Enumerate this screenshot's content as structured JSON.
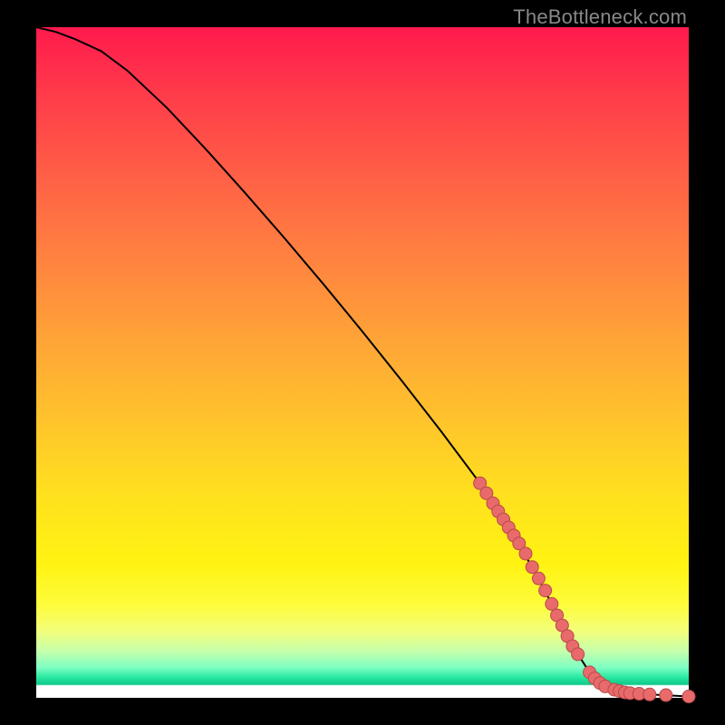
{
  "watermark": "TheBottleneck.com",
  "chart_data": {
    "type": "line",
    "title": "",
    "xlabel": "",
    "ylabel": "",
    "xlim": [
      0,
      100
    ],
    "ylim": [
      0,
      100
    ],
    "grid": false,
    "curve": {
      "x": [
        0,
        3,
        6,
        10,
        14,
        20,
        26,
        32,
        38,
        44,
        50,
        56,
        62,
        68,
        72,
        76,
        79,
        81,
        83,
        85,
        88,
        92,
        96,
        100
      ],
      "y": [
        100,
        99.3,
        98.2,
        96.4,
        93.5,
        88.0,
        81.8,
        75.3,
        68.6,
        61.7,
        54.6,
        47.3,
        39.8,
        32.0,
        26.0,
        19.5,
        14.0,
        10.0,
        6.5,
        3.5,
        1.5,
        0.6,
        0.4,
        0.2
      ]
    },
    "markers": {
      "x": [
        68.0,
        69.0,
        70.0,
        70.8,
        71.6,
        72.4,
        73.2,
        74.0,
        75.0,
        76.0,
        77.0,
        78.0,
        79.0,
        79.8,
        80.6,
        81.4,
        82.2,
        83.0,
        84.8,
        85.6,
        86.4,
        87.2,
        88.6,
        89.4,
        90.2,
        91.0,
        92.4,
        94.0,
        96.5,
        100.0
      ],
      "y": [
        32.0,
        30.5,
        29.0,
        27.8,
        26.6,
        25.4,
        24.2,
        23.0,
        21.5,
        19.5,
        17.8,
        16.0,
        14.0,
        12.3,
        10.8,
        9.2,
        7.7,
        6.5,
        3.8,
        2.9,
        2.2,
        1.7,
        1.2,
        1.0,
        0.8,
        0.7,
        0.6,
        0.5,
        0.4,
        0.2
      ]
    }
  }
}
